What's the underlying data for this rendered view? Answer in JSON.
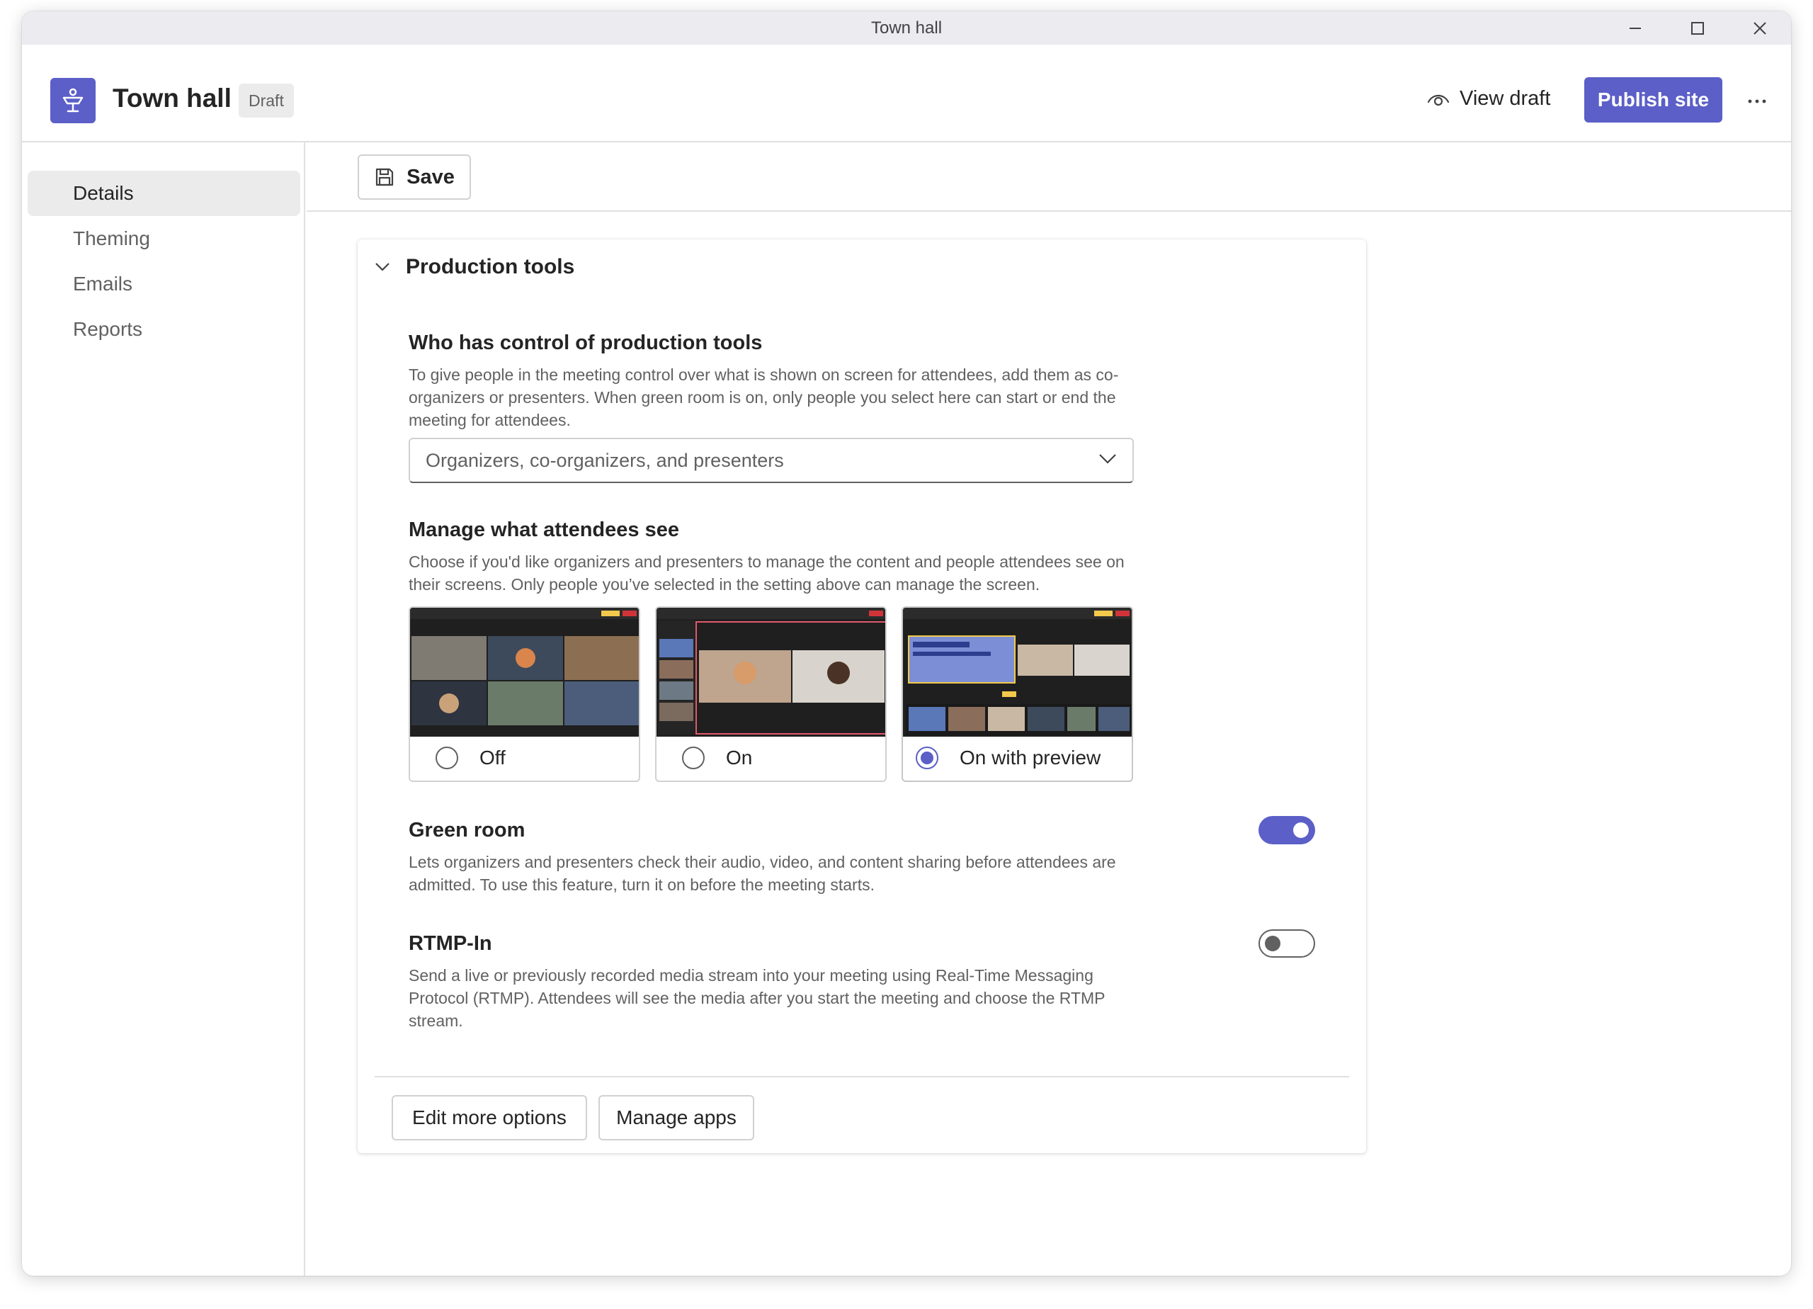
{
  "window": {
    "title": "Town hall"
  },
  "header": {
    "app_title": "Town hall",
    "badge": "Draft",
    "view_draft": "View draft",
    "publish": "Publish site",
    "more": "…"
  },
  "sidebar": {
    "items": [
      {
        "label": "Details",
        "active": true
      },
      {
        "label": "Theming",
        "active": false
      },
      {
        "label": "Emails",
        "active": false
      },
      {
        "label": "Reports",
        "active": false
      }
    ]
  },
  "toolbar": {
    "save_label": "Save"
  },
  "production": {
    "title": "Production tools",
    "control": {
      "title": "Who has control of production tools",
      "description": "To give people in the meeting control over what is shown on screen for attendees, add them as co-organizers or presenters. When green room is on, only people you select here can start or end the meeting for attendees.",
      "selected": "Organizers, co-organizers, and presenters"
    },
    "manage": {
      "title": "Manage what attendees see",
      "description": "Choose if you'd like organizers and presenters to manage the content and people attendees see on their screens. Only people you’ve selected in the setting above can manage the screen.",
      "options": [
        {
          "label": "Off",
          "checked": false
        },
        {
          "label": "On",
          "checked": false
        },
        {
          "label": "On with preview",
          "checked": true
        }
      ]
    },
    "green_room": {
      "title": "Green room",
      "description": "Lets organizers and presenters check their audio, video, and content sharing before attendees are admitted. To use this feature, turn it on before the meeting starts.",
      "enabled": true
    },
    "rtmp": {
      "title": "RTMP-In",
      "description": "Send a live or previously recorded media stream into your meeting using Real-Time Messaging Protocol (RTMP). Attendees will see the media after you start the meeting and choose the RTMP stream.",
      "enabled": false
    },
    "footer": {
      "edit_more": "Edit more options",
      "manage_apps": "Manage apps"
    }
  },
  "colors": {
    "accent": "#5b5fc7",
    "text_secondary": "#616161",
    "border": "#d1d1d1"
  }
}
